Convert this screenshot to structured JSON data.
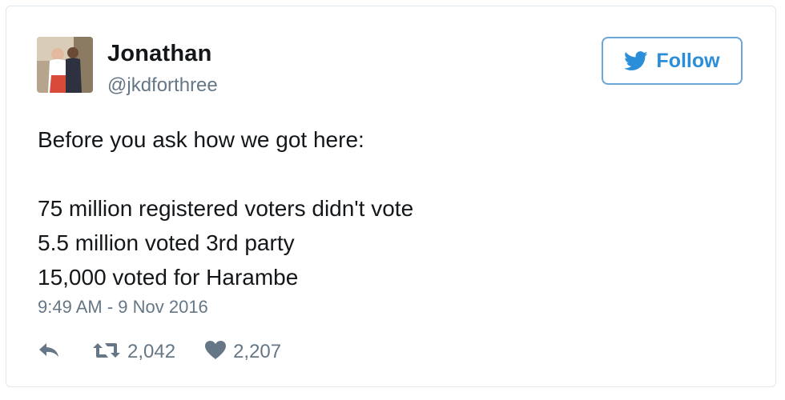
{
  "user": {
    "name": "Jonathan",
    "handle": "@jkdforthree"
  },
  "follow_button": {
    "label": "Follow"
  },
  "tweet": {
    "lines": [
      "Before you ask how we got here:",
      "",
      "75 million registered voters didn't vote",
      "5.5 million voted 3rd party",
      "15,000 voted for Harambe"
    ],
    "timestamp": "9:49 AM - 9 Nov 2016"
  },
  "actions": {
    "retweet_count": "2,042",
    "like_count": "2,207"
  },
  "icons": {
    "reply": "reply-icon",
    "retweet": "retweet-icon",
    "like": "heart-icon",
    "brand": "twitter-bird-icon"
  },
  "colors": {
    "accent": "#2b8ed8",
    "follow_border": "#6aa6d8",
    "muted": "#657786",
    "text": "#14171a",
    "card_border": "#e1e8ed"
  }
}
